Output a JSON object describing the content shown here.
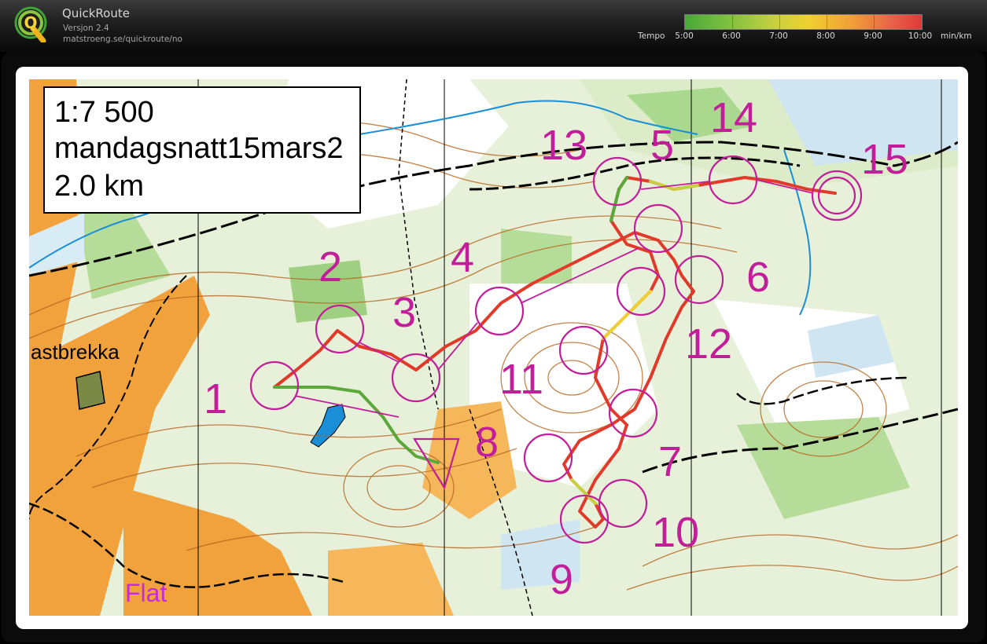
{
  "app": {
    "name": "QuickRoute",
    "version": "Versjon 2.4",
    "url": "matstroeng.se/quickroute/no",
    "logo_letter": "Q"
  },
  "legend": {
    "label": "Tempo",
    "ticks": [
      "5:00",
      "6:00",
      "7:00",
      "8:00",
      "9:00",
      "10:00"
    ],
    "unit": "min/km"
  },
  "info": {
    "scale": "1:7 500",
    "name": "mandagsnatt15mars2",
    "distance": "2.0 km"
  },
  "map": {
    "place_labels": [
      "astbrekka",
      "Flat"
    ],
    "controls": [
      "1",
      "2",
      "3",
      "4",
      "5",
      "6",
      "7",
      "8",
      "9",
      "10",
      "11",
      "12",
      "13",
      "14",
      "15"
    ],
    "colors": {
      "course": "#c21e9a",
      "route_slow": "#e23a2a",
      "route_fast": "#5aa83c",
      "lake": "#1a8fd8"
    }
  }
}
